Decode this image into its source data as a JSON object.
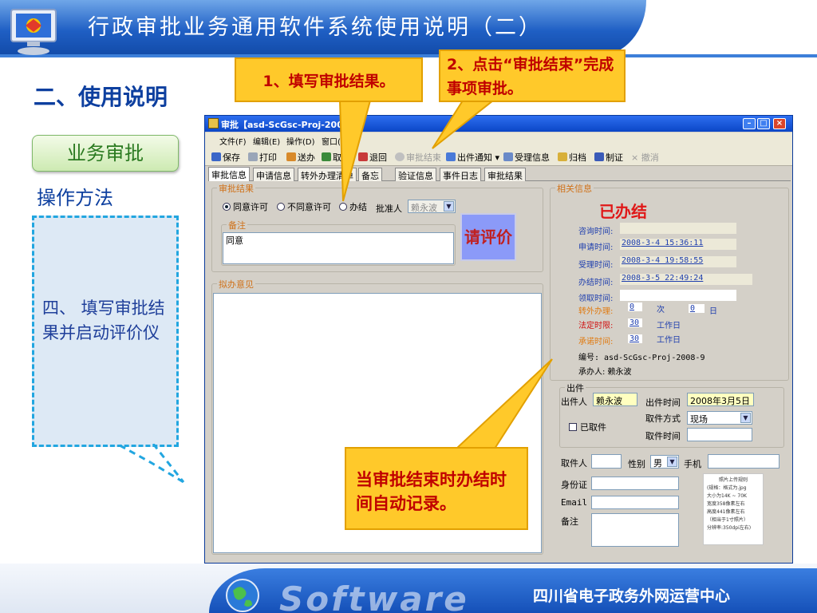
{
  "slide": {
    "title": "行政审批业务通用软件系统使用说明（二）",
    "section_title": "二、使用说明",
    "business_button": "业务审批",
    "operation_method": "操作方法",
    "note": "四、 填写审批结果并启动评价仪",
    "footer_brand": "Software",
    "footer_org": "四川省电子政务外网运营中心"
  },
  "callouts": {
    "step1": "1、填写审批结果。",
    "step2": "2、点击“审批结束”完成事项审批。",
    "step3": "当审批结束时办结时间自动记录。"
  },
  "app": {
    "window_title": "审批【asd-ScGsc-Proj-2008-9】",
    "menu": [
      "文件(F)",
      "编辑(E)",
      "操作(D)",
      "窗口(W)"
    ],
    "toolbar": {
      "save": "保存",
      "print": "打印",
      "send": "送办",
      "retrieve": "取回",
      "return": "退回",
      "finish": "审批结束",
      "notify": "出件通知",
      "accept_info": "受理信息",
      "archive": "归档",
      "certify": "制证",
      "undo": "撤消"
    },
    "tabs": [
      "审批信息",
      "申请信息",
      "转外办理清单",
      "备忘",
      "验证信息",
      "事件日志",
      "审批结果"
    ],
    "approval": {
      "group_label": "审批结果",
      "options": [
        "同意许可",
        "不同意许可",
        "办结"
      ],
      "selected_option": "同意许可",
      "approver_label": "批准人",
      "approver_value": "赖永波",
      "remarks_label": "备注",
      "remarks_value": "同意",
      "rate_button": "请评价"
    },
    "opinion": {
      "group_label": "拟办意见"
    },
    "related": {
      "group_label": "相关信息",
      "status": "已办结",
      "consult_time_label": "咨询时间:",
      "consult_time": "",
      "apply_time_label": "申请时间:",
      "apply_time": "2008-3-4 15:36:11",
      "accept_time_label": "受理时间:",
      "accept_time": "2008-3-4 19:58:55",
      "finish_time_label": "办结时间:",
      "finish_time": "2008-3-5 22:49:24",
      "collect_time_label": "领取时间:",
      "collect_time": "",
      "transfer_label": "转外办理:",
      "transfer_count": "0",
      "transfer_unit": "次",
      "transfer_days": "0",
      "transfer_day_unit": "日",
      "legal_limit_label": "法定时限:",
      "legal_limit": "30",
      "legal_unit": "工作日",
      "promise_label": "承诺时间:",
      "promise": "30",
      "promise_unit": "工作日",
      "number_line": "编号: asd-ScGsc-Proj-2008-9",
      "handler_line": "承办人: 赖永波"
    },
    "delivery": {
      "group_label": "出件",
      "issuer_label": "出件人",
      "issuer": "赖永波",
      "issue_time_label": "出件时间",
      "issue_time": "2008年3月5日 2",
      "collected_label": "已取件",
      "method_label": "取件方式",
      "method": "现场",
      "pickup_time_label": "取件时间",
      "pickup_time": ""
    },
    "pickup": {
      "person_label": "取件人",
      "gender_label": "性别",
      "gender": "男",
      "phone_label": "手机",
      "id_label": "身份证",
      "email_label": "Email",
      "remark_label": "备注",
      "photo_note": [
        "照片上传规则",
        "(规格：格式为.jpg",
        "大小为14K ~ 70K",
        "宽度358像素左右",
        "高度441像素左右",
        "（相当于1寸照片）",
        "分辨率:350dpi左右)"
      ]
    }
  },
  "colors": {
    "header_blue": "#1f5fc4",
    "callout_fill": "#ffc92a",
    "callout_text": "#c00000",
    "status_red": "#e01818",
    "rate_button": "#8b9af8"
  }
}
